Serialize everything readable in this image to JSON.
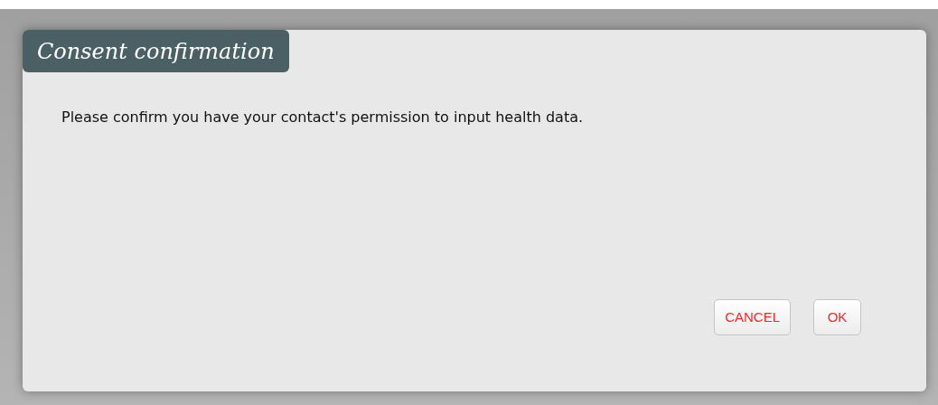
{
  "dialog": {
    "title": "Consent confirmation",
    "message": "Please confirm you have your contact's permission to input health data.",
    "buttons": [
      "CANCEL",
      "OK"
    ]
  }
}
